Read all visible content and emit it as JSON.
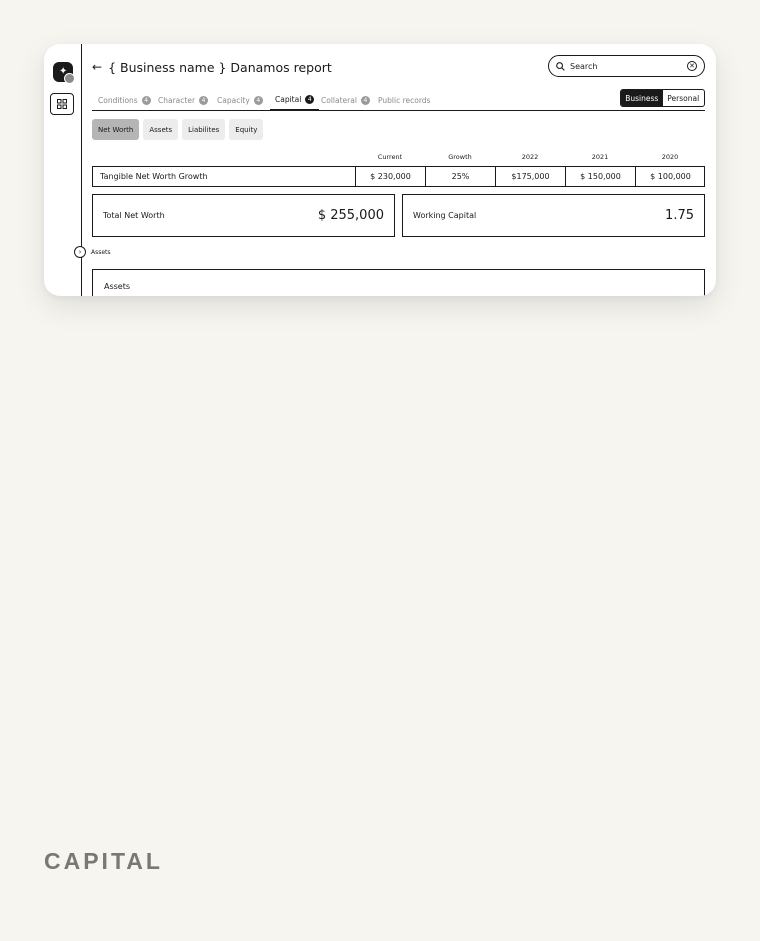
{
  "app": {
    "title": "{ Business name } Danamos report",
    "back_icon": "arrow-left-icon"
  },
  "search": {
    "placeholder": "Search"
  },
  "tabs": [
    {
      "label": "Conditions",
      "badge": "4"
    },
    {
      "label": "Character",
      "badge": "4"
    },
    {
      "label": "Capacity",
      "badge": "4"
    },
    {
      "label": "Capital",
      "badge": "4",
      "active": true
    },
    {
      "label": "Collateral",
      "badge": "4"
    },
    {
      "label": "Public records"
    }
  ],
  "toggle": {
    "business": "Business",
    "personal": "Personal",
    "selected": "Business"
  },
  "subtabs": [
    {
      "label": "Net Worth",
      "active": true
    },
    {
      "label": "Assets"
    },
    {
      "label": "Liabilites"
    },
    {
      "label": "Equity"
    }
  ],
  "table": {
    "columns": [
      "Current",
      "Growth",
      "2022",
      "2021",
      "2020"
    ],
    "row": {
      "label": "Tangible Net Worth  Growth",
      "values": [
        "$ 230,000",
        "25%",
        "$175,000",
        "$ 150,000",
        "$ 100,000"
      ]
    }
  },
  "kpis": {
    "total_net_worth": {
      "label": "Total Net Worth",
      "value": "$ 255,000"
    },
    "working_capital": {
      "label": "Working Capital",
      "value": "1.75"
    }
  },
  "assets_section": {
    "toggle_label": "Assets",
    "box_title": "Assets"
  },
  "caption": "CAPITAL",
  "colors": {
    "accent": "#1a1a1a",
    "muted": "#8a8a8a",
    "chip": "#ececec",
    "chip_active": "#b5b5b5",
    "background": "#f7f5f0"
  }
}
